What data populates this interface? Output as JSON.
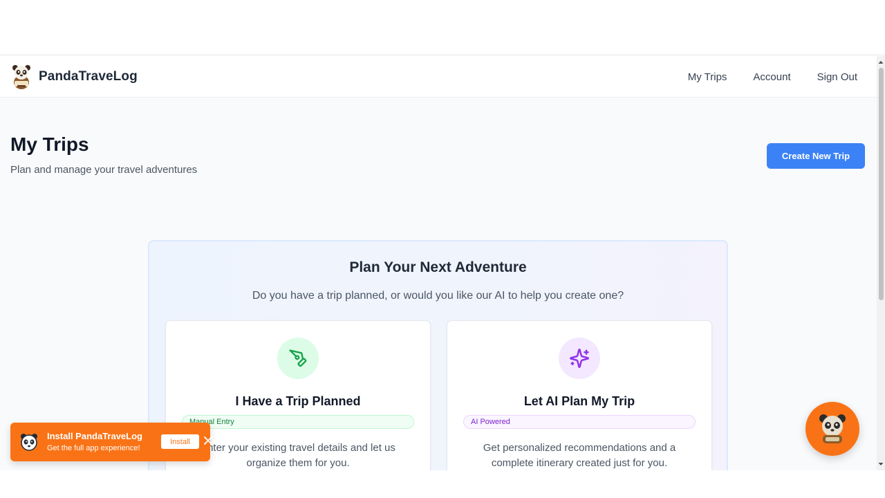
{
  "brand": {
    "name": "PandaTraveLog",
    "logo_icon": "panda-mascot-icon"
  },
  "nav": {
    "links": [
      "My Trips",
      "Account",
      "Sign Out"
    ]
  },
  "header": {
    "title": "My Trips",
    "subtitle": "Plan and manage your travel adventures",
    "create_button": "Create New Trip"
  },
  "plan_section": {
    "title": "Plan Your Next Adventure",
    "subtitle": "Do you have a trip planned, or would you like our AI to help you create one?",
    "options": [
      {
        "title": "I Have a Trip Planned",
        "badge": "Manual Entry",
        "description": "Enter your existing travel details and let us organize them for you.",
        "icon": "pen-tool-icon",
        "accent": "#16a34a"
      },
      {
        "title": "Let AI Plan My Trip",
        "badge": "AI Powered",
        "description": "Get personalized recommendations and a complete itinerary created just for you.",
        "icon": "sparkles-icon",
        "accent": "#9333ea"
      }
    ]
  },
  "install_banner": {
    "title": "Install PandaTraveLog",
    "subtitle": "Get the full app experience!",
    "button": "Install",
    "close_icon": "close-icon"
  },
  "assistant_button": {
    "icon": "panda-assistant-icon"
  },
  "colors": {
    "primary": "#3b82f6",
    "banner": "#f97316",
    "manual_accent": "#16a34a",
    "ai_accent": "#9333ea"
  }
}
